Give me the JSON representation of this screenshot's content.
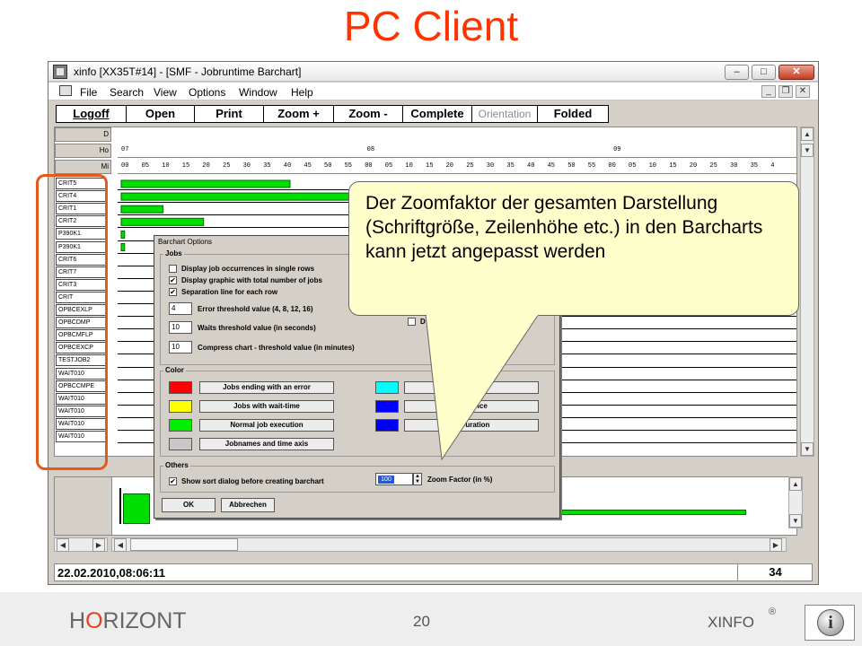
{
  "slide": {
    "title": "PC Client",
    "page_number": "20",
    "brand": {
      "prefix": "H",
      "o": "O",
      "suffix": "RIZONT"
    },
    "product": "XINFO",
    "registered": "®",
    "info_icon_glyph": "i"
  },
  "window": {
    "title": "xinfo [XX35T#14] - [SMF - Jobruntime Barchart]",
    "buttons": {
      "minimize": "–",
      "maximize": "□",
      "close": "✕"
    },
    "mdi_buttons": {
      "minimize": "_",
      "restore": "❐",
      "close": "✕"
    },
    "menu": [
      "File",
      "Search",
      "View",
      "Options",
      "Window",
      "Help"
    ],
    "toolbar": [
      {
        "label": "Logoff",
        "enabled": true,
        "underline": true
      },
      {
        "label": "Open",
        "enabled": true,
        "underline": false
      },
      {
        "label": "Print",
        "enabled": true,
        "underline": false
      },
      {
        "label": "Zoom +",
        "enabled": true,
        "underline": false
      },
      {
        "label": "Zoom -",
        "enabled": true,
        "underline": false
      },
      {
        "label": "Complete",
        "enabled": true,
        "underline": false
      },
      {
        "label": "Orientation",
        "enabled": false,
        "underline": false
      },
      {
        "label": "Folded",
        "enabled": true,
        "underline": false
      }
    ],
    "header_cells": [
      "D",
      "Ho",
      "Mi"
    ],
    "hour_labels": [
      {
        "text": "07",
        "pos": 0.0
      },
      {
        "text": "08",
        "pos": 0.362
      },
      {
        "text": "09",
        "pos": 0.725
      }
    ],
    "minute_labels": [
      "00",
      "05",
      "10",
      "15",
      "20",
      "25",
      "30",
      "35",
      "40",
      "45",
      "50",
      "55",
      "00",
      "05",
      "10",
      "15",
      "20",
      "25",
      "30",
      "35",
      "40",
      "45",
      "50",
      "55",
      "00",
      "05",
      "10",
      "15",
      "20",
      "25",
      "30",
      "35",
      "4"
    ],
    "jobs": [
      "CRIT5",
      "CRIT4",
      "CRIT1",
      "CRIT2",
      "P390K1",
      "P390K1",
      "CRIT6",
      "CRIT7",
      "CRIT3",
      "CRIT",
      "OPBCEXLP",
      "OPBCDMP",
      "OPBCMFLP",
      "OPBCEXCP",
      "TESTJOB2",
      "WAIT010",
      "OPBCCMPE",
      "WAIT010",
      "WAIT010",
      "WAIT010",
      "WAIT010"
    ],
    "status_time": "22.02.2010,08:06:11",
    "status_number": "34"
  },
  "chart_data": {
    "type": "bar",
    "title": "",
    "categories": [
      "CRIT5",
      "CRIT4",
      "CRIT1",
      "CRIT2",
      "P390K1",
      "P390K1"
    ],
    "series": [
      {
        "start": [
          0.0,
          0.0,
          0.0,
          0.0,
          0.0,
          0.0
        ],
        "end": [
          0.25,
          0.5,
          0.062,
          0.122,
          0.005,
          0.005
        ]
      }
    ],
    "xlabel": "",
    "ylabel": "",
    "color": "#00dd00"
  },
  "dialog": {
    "title": "Barchart Options",
    "jobs_group": "Jobs",
    "checkboxes": [
      {
        "label": "Display job occurrences in single rows",
        "checked": false
      },
      {
        "label": "Display graphic with total number of jobs",
        "checked": true
      },
      {
        "label": "Separation line for each row",
        "checked": true
      }
    ],
    "right_checkbox": {
      "label": "D",
      "checked": false
    },
    "fields": [
      {
        "value": "4",
        "label": "Error threshold value (4, 8, 12, 16)"
      },
      {
        "value": "10",
        "label": "Waits threshold value (in seconds)"
      },
      {
        "value": "10",
        "label": "Compress chart - threshold value (in minutes)"
      }
    ],
    "color_group": "Color",
    "colors_left": [
      {
        "color": "#ff0000",
        "label": "Jobs ending with an error"
      },
      {
        "color": "#ffff00",
        "label": "Jobs with wait-time"
      },
      {
        "color": "#00ee00",
        "label": "Normal job execution"
      },
      {
        "color": "#c8c8c8",
        "label": "Jobnames and time axis"
      }
    ],
    "colors_right": [
      {
        "color": "#00ffff",
        "label": "W                   eue"
      },
      {
        "color": "#0000ff",
        "label": "W              Device"
      },
      {
        "color": "#0000ee",
        "label": "R        Duration"
      }
    ],
    "others_group": "Others",
    "sort_checkbox": {
      "label": "Show sort dialog before creating barchart",
      "checked": true
    },
    "zoom_value": "100",
    "zoom_label": "Zoom Factor (in %)",
    "ok": "OK",
    "cancel": "Abbrechen"
  },
  "callout": {
    "text": "Der Zoomfaktor der gesamten Darstellung (Schriftgröße, Zeilenhöhe etc.) in den Barcharts kann jetzt angepasst werden"
  }
}
